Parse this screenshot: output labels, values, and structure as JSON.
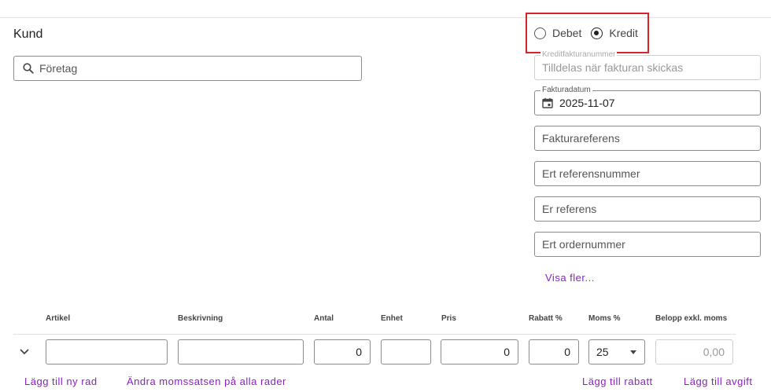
{
  "customer": {
    "title": "Kund",
    "search_placeholder": "Företag"
  },
  "invoice_type": {
    "options": [
      {
        "label": "Debet",
        "selected": false
      },
      {
        "label": "Kredit",
        "selected": true
      }
    ]
  },
  "invoice_fields": {
    "credit_invoice_number": {
      "label": "Kreditfakturanummer",
      "placeholder": "Tilldelas när fakturan skickas"
    },
    "invoice_date": {
      "label": "Fakturadatum",
      "value": "2025-11-07",
      "icon": "calendar-icon"
    },
    "invoice_reference": {
      "placeholder": "Fakturareferens"
    },
    "your_reference_number": {
      "placeholder": "Ert referensnummer"
    },
    "our_reference": {
      "placeholder": "Er referens"
    },
    "your_order_number": {
      "placeholder": "Ert ordernummer"
    },
    "show_more": "Visa fler..."
  },
  "lines_table": {
    "headers": {
      "article": "Artikel",
      "description": "Beskrivning",
      "quantity": "Antal",
      "unit": "Enhet",
      "price": "Pris",
      "discount": "Rabatt %",
      "vat": "Moms %",
      "amount": "Belopp exkl. moms"
    },
    "row": {
      "article": "",
      "description": "",
      "quantity": "0",
      "unit": "",
      "price": "0",
      "discount": "0",
      "vat": "25",
      "amount": "0,00"
    }
  },
  "actions": {
    "add_row": "Lägg till ny rad",
    "change_vat_all": "Ändra momssatsen på alla rader",
    "add_discount": "Lägg till rabatt",
    "add_fee": "Lägg till avgift"
  },
  "colors": {
    "link": "#8a1fc4",
    "highlight_border": "#d9232d",
    "input_border": "#8c8c8c"
  }
}
